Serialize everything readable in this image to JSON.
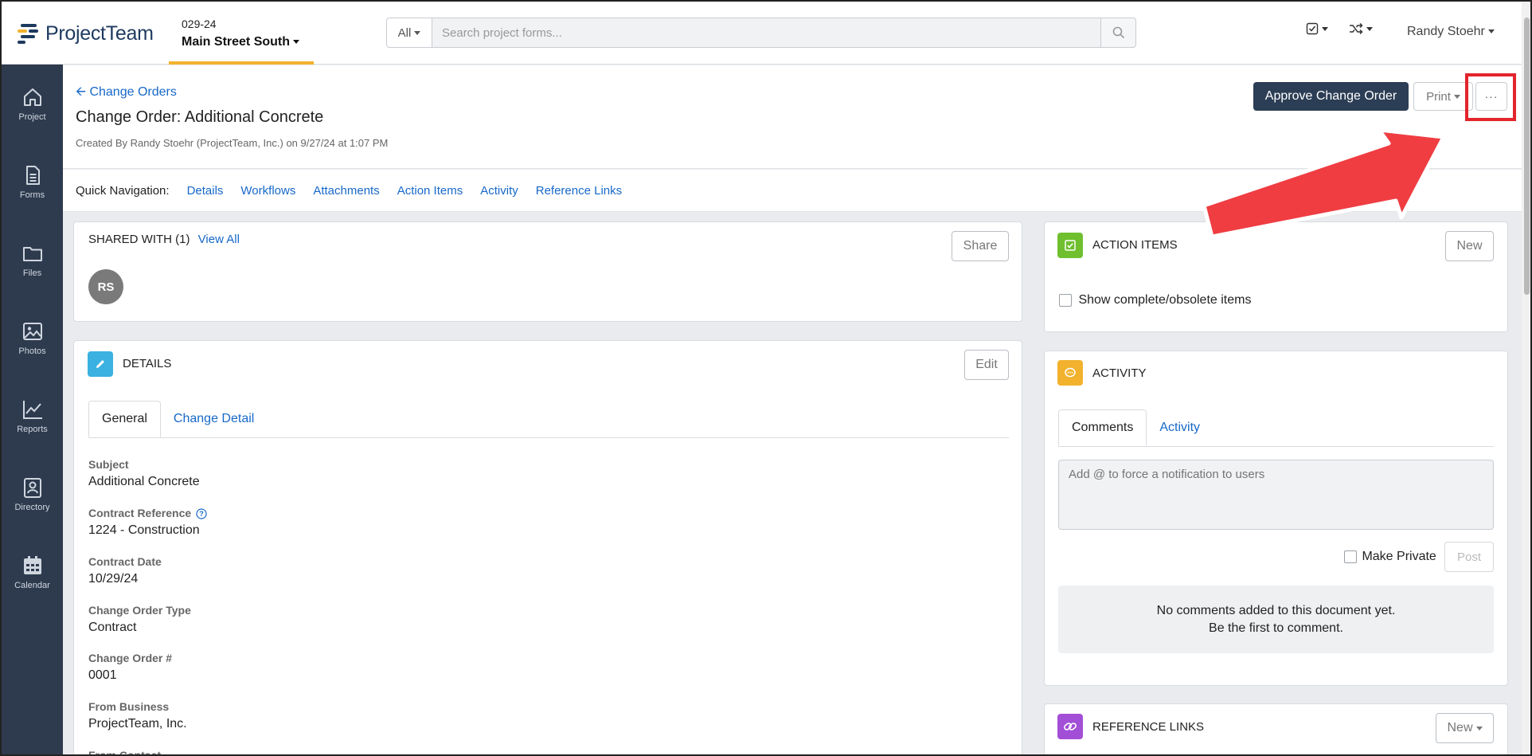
{
  "header": {
    "logo_text": "ProjectTeam",
    "project_code": "029-24",
    "project_name": "Main Street South",
    "search_scope": "All",
    "search_placeholder": "Search project forms...",
    "user_name": "Randy Stoehr"
  },
  "sidebar": {
    "items": [
      {
        "label": "Project",
        "icon": "home-icon"
      },
      {
        "label": "Forms",
        "icon": "document-icon"
      },
      {
        "label": "Files",
        "icon": "folder-icon"
      },
      {
        "label": "Photos",
        "icon": "image-icon"
      },
      {
        "label": "Reports",
        "icon": "chart-icon"
      },
      {
        "label": "Directory",
        "icon": "contact-icon"
      },
      {
        "label": "Calendar",
        "icon": "calendar-icon"
      }
    ]
  },
  "page": {
    "back_link": "Change Orders",
    "title": "Change Order: Additional Concrete",
    "created": "Created By Randy Stoehr (ProjectTeam, Inc.) on 9/27/24 at 1:07 PM",
    "approve_label": "Approve Change Order",
    "print_label": "Print",
    "more_label": "···"
  },
  "quicknav": {
    "label": "Quick Navigation:",
    "links": [
      "Details",
      "Workflows",
      "Attachments",
      "Action Items",
      "Activity",
      "Reference Links"
    ]
  },
  "shared": {
    "title": "SHARED WITH (1)",
    "view_all": "View All",
    "share_label": "Share",
    "avatar_initials": "RS"
  },
  "details": {
    "title": "DETAILS",
    "edit_label": "Edit",
    "tabs": [
      "General",
      "Change Detail"
    ],
    "fields": [
      {
        "label": "Subject",
        "value": "Additional Concrete"
      },
      {
        "label": "Contract Reference",
        "value": "1224 - Construction"
      },
      {
        "label": "Contract Date",
        "value": "10/29/24"
      },
      {
        "label": "Change Order Type",
        "value": "Contract"
      },
      {
        "label": "Change Order #",
        "value": "0001"
      },
      {
        "label": "From Business",
        "value": "ProjectTeam, Inc."
      },
      {
        "label": "From Contact",
        "value": ""
      }
    ]
  },
  "action_items": {
    "title": "ACTION ITEMS",
    "new_label": "New",
    "show_complete": "Show complete/obsolete items"
  },
  "activity": {
    "title": "ACTIVITY",
    "tabs": [
      "Comments",
      "Activity"
    ],
    "comment_placeholder": "Add @ to force a notification to users",
    "make_private": "Make Private",
    "post_label": "Post",
    "empty_line1": "No comments added to this document yet.",
    "empty_line2": "Be the first to comment."
  },
  "reference_links": {
    "title": "REFERENCE LINKS",
    "new_label": "New"
  },
  "colors": {
    "accent": "#1769c9",
    "navy": "#2c3e55",
    "sidebar": "#2e3b4e",
    "tab_underline": "#f2b22e",
    "highlight_red": "#e3242b"
  }
}
